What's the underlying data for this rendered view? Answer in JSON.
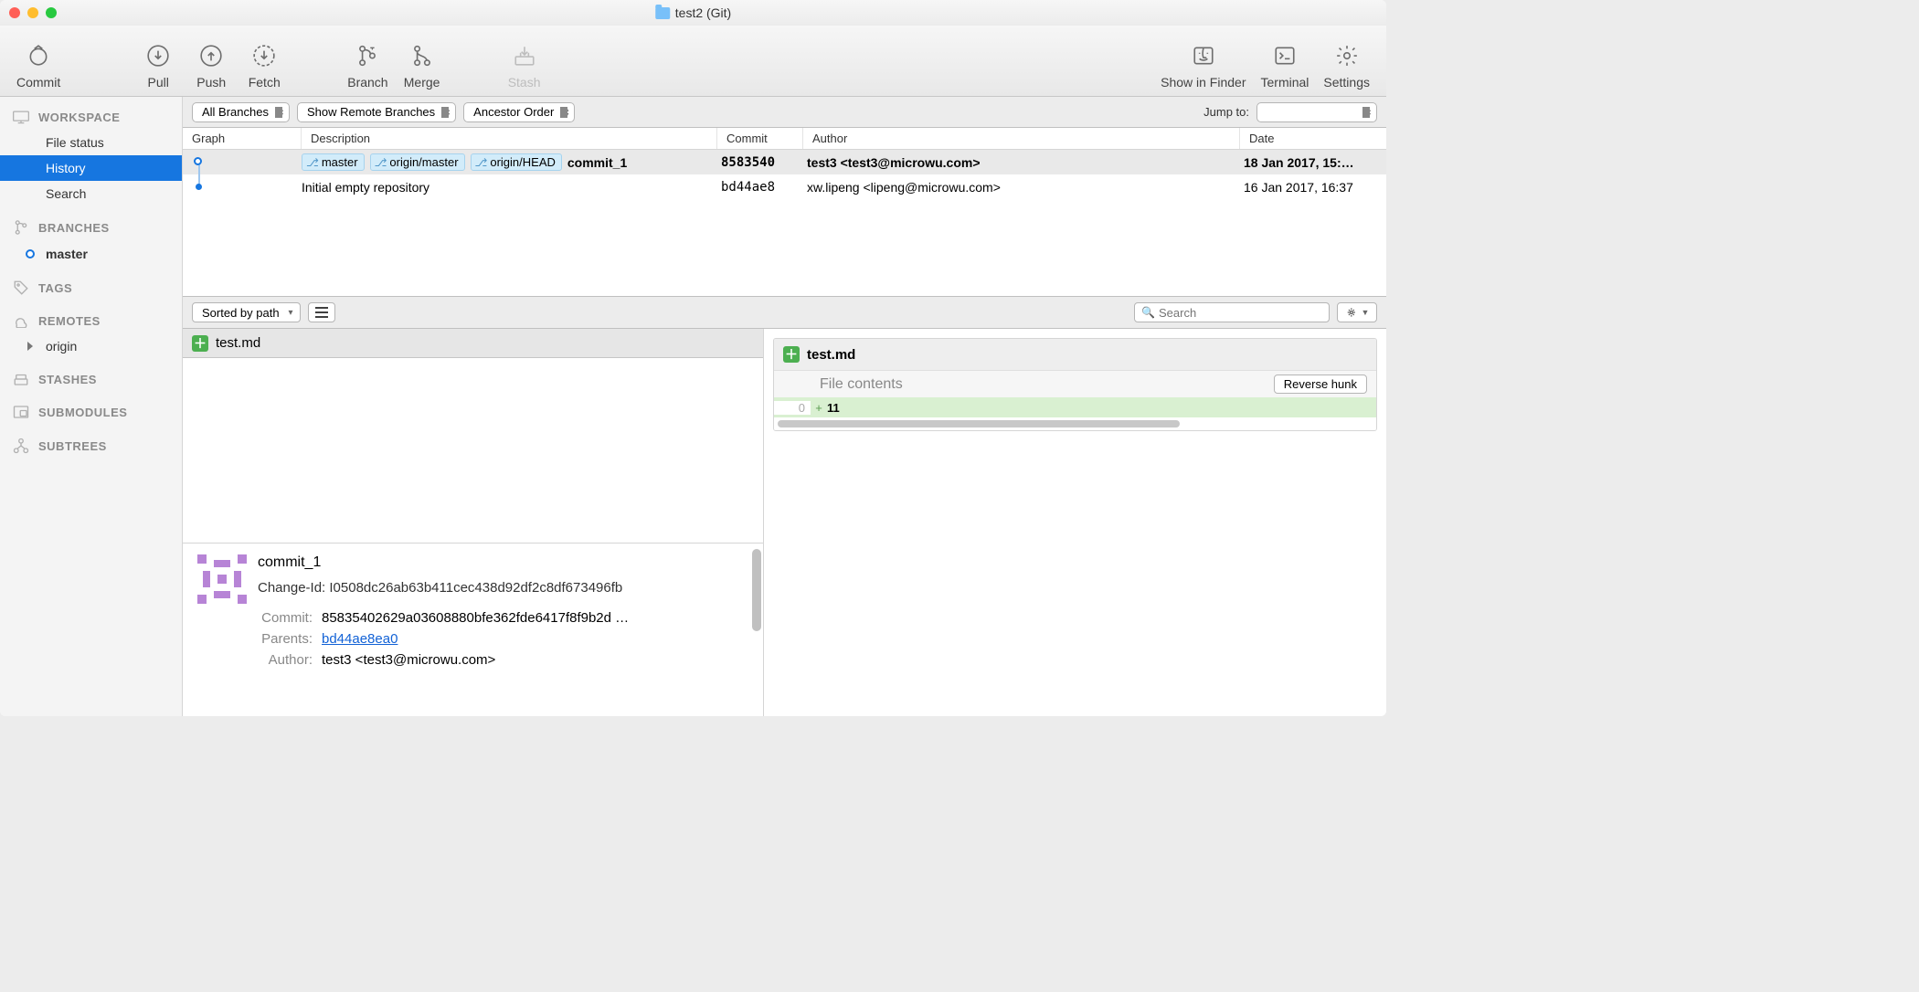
{
  "title": "test2 (Git)",
  "toolbar": {
    "commit": "Commit",
    "pull": "Pull",
    "push": "Push",
    "fetch": "Fetch",
    "branch": "Branch",
    "merge": "Merge",
    "stash": "Stash",
    "showInFinder": "Show in Finder",
    "terminal": "Terminal",
    "settings": "Settings"
  },
  "sidebar": {
    "workspace": {
      "heading": "WORKSPACE",
      "items": [
        "File status",
        "History",
        "Search"
      ],
      "selectedIndex": 1
    },
    "branches": {
      "heading": "BRANCHES",
      "items": [
        "master"
      ]
    },
    "tags": {
      "heading": "TAGS"
    },
    "remotes": {
      "heading": "REMOTES",
      "items": [
        "origin"
      ]
    },
    "stashes": {
      "heading": "STASHES"
    },
    "submodules": {
      "heading": "SUBMODULES"
    },
    "subtrees": {
      "heading": "SUBTREES"
    }
  },
  "filters": {
    "branchFilter": "All Branches",
    "remoteFilter": "Show Remote Branches",
    "order": "Ancestor Order",
    "jumpLabel": "Jump to:"
  },
  "table": {
    "headers": {
      "graph": "Graph",
      "description": "Description",
      "commit": "Commit",
      "author": "Author",
      "date": "Date"
    },
    "rows": [
      {
        "selected": true,
        "refs": [
          "master",
          "origin/master",
          "origin/HEAD"
        ],
        "description": "commit_1",
        "commit": "8583540",
        "author": "test3 <test3@microwu.com>",
        "date": "18 Jan 2017, 15:…"
      },
      {
        "selected": false,
        "refs": [],
        "description": "Initial empty repository",
        "commit": "bd44ae8",
        "author": "xw.lipeng <lipeng@microwu.com>",
        "date": "16 Jan 2017, 16:37"
      }
    ]
  },
  "midbar": {
    "sort": "Sorted by path",
    "searchPlaceholder": "Search"
  },
  "fileTab": {
    "name": "test.md"
  },
  "commitDetail": {
    "title": "commit_1",
    "changeId": "Change-Id: I0508dc26ab63b411cec438d92df2c8df673496fb",
    "commitLabel": "Commit:",
    "commitHash": "85835402629a03608880bfe362fde6417f8f9b2d …",
    "parentsLabel": "Parents:",
    "parentsHash": "bd44ae8ea0",
    "authorLabel": "Author:",
    "authorValue": "test3 <test3@microwu.com>"
  },
  "diff": {
    "file": "test.md",
    "hunkHeader": "File contents",
    "reverseHunk": "Reverse hunk",
    "lineNo": "0",
    "lineContent": "11"
  }
}
